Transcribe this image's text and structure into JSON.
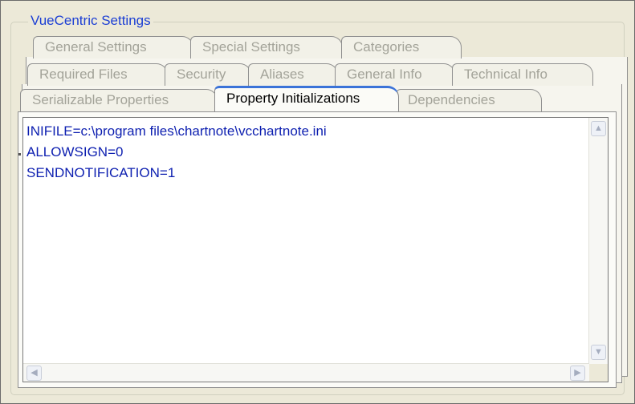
{
  "group": {
    "title": "VueCentric Settings"
  },
  "tabs": {
    "row1": [
      {
        "label": "General Settings"
      },
      {
        "label": "Special Settings"
      },
      {
        "label": "Categories"
      }
    ],
    "row2": [
      {
        "label": "Required Files"
      },
      {
        "label": "Security"
      },
      {
        "label": "Aliases"
      },
      {
        "label": "General Info"
      },
      {
        "label": "Technical Info"
      }
    ],
    "row3": [
      {
        "label": "Serializable Properties"
      },
      {
        "label": "Property Initializations",
        "active": true
      },
      {
        "label": "Dependencies"
      }
    ]
  },
  "editor": {
    "text": "INIFILE=c:\\program files\\chartnote\\vcchartnote.ini\nALLOWSIGN=0\nSENDNOTIFICATION=1"
  },
  "scroll": {
    "up_icon": "chevron-up-icon",
    "down_icon": "chevron-down-icon",
    "left_icon": "chevron-left-icon",
    "right_icon": "chevron-right-icon"
  },
  "colors": {
    "title": "#1c3fd4",
    "text": "#0d1fb0",
    "active_tab_accent": "#3b73d8"
  }
}
